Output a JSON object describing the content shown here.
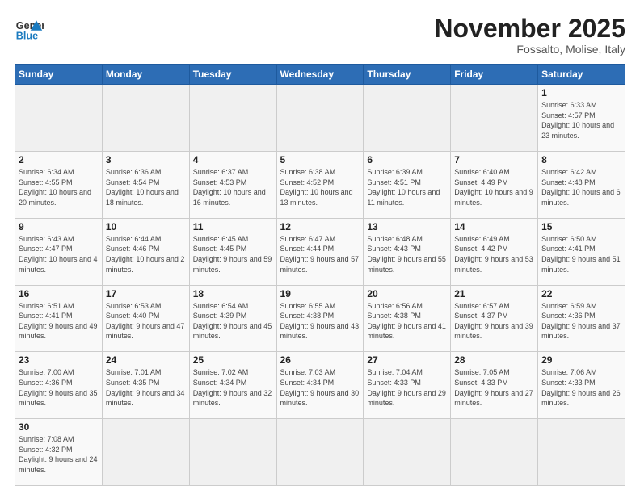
{
  "logo": {
    "text_general": "General",
    "text_blue": "Blue"
  },
  "header": {
    "month": "November 2025",
    "location": "Fossalto, Molise, Italy"
  },
  "weekdays": [
    "Sunday",
    "Monday",
    "Tuesday",
    "Wednesday",
    "Thursday",
    "Friday",
    "Saturday"
  ],
  "weeks": [
    [
      {
        "day": "",
        "info": ""
      },
      {
        "day": "",
        "info": ""
      },
      {
        "day": "",
        "info": ""
      },
      {
        "day": "",
        "info": ""
      },
      {
        "day": "",
        "info": ""
      },
      {
        "day": "",
        "info": ""
      },
      {
        "day": "1",
        "info": "Sunrise: 6:33 AM\nSunset: 4:57 PM\nDaylight: 10 hours and 23 minutes."
      }
    ],
    [
      {
        "day": "2",
        "info": "Sunrise: 6:34 AM\nSunset: 4:55 PM\nDaylight: 10 hours and 20 minutes."
      },
      {
        "day": "3",
        "info": "Sunrise: 6:36 AM\nSunset: 4:54 PM\nDaylight: 10 hours and 18 minutes."
      },
      {
        "day": "4",
        "info": "Sunrise: 6:37 AM\nSunset: 4:53 PM\nDaylight: 10 hours and 16 minutes."
      },
      {
        "day": "5",
        "info": "Sunrise: 6:38 AM\nSunset: 4:52 PM\nDaylight: 10 hours and 13 minutes."
      },
      {
        "day": "6",
        "info": "Sunrise: 6:39 AM\nSunset: 4:51 PM\nDaylight: 10 hours and 11 minutes."
      },
      {
        "day": "7",
        "info": "Sunrise: 6:40 AM\nSunset: 4:49 PM\nDaylight: 10 hours and 9 minutes."
      },
      {
        "day": "8",
        "info": "Sunrise: 6:42 AM\nSunset: 4:48 PM\nDaylight: 10 hours and 6 minutes."
      }
    ],
    [
      {
        "day": "9",
        "info": "Sunrise: 6:43 AM\nSunset: 4:47 PM\nDaylight: 10 hours and 4 minutes."
      },
      {
        "day": "10",
        "info": "Sunrise: 6:44 AM\nSunset: 4:46 PM\nDaylight: 10 hours and 2 minutes."
      },
      {
        "day": "11",
        "info": "Sunrise: 6:45 AM\nSunset: 4:45 PM\nDaylight: 9 hours and 59 minutes."
      },
      {
        "day": "12",
        "info": "Sunrise: 6:47 AM\nSunset: 4:44 PM\nDaylight: 9 hours and 57 minutes."
      },
      {
        "day": "13",
        "info": "Sunrise: 6:48 AM\nSunset: 4:43 PM\nDaylight: 9 hours and 55 minutes."
      },
      {
        "day": "14",
        "info": "Sunrise: 6:49 AM\nSunset: 4:42 PM\nDaylight: 9 hours and 53 minutes."
      },
      {
        "day": "15",
        "info": "Sunrise: 6:50 AM\nSunset: 4:41 PM\nDaylight: 9 hours and 51 minutes."
      }
    ],
    [
      {
        "day": "16",
        "info": "Sunrise: 6:51 AM\nSunset: 4:41 PM\nDaylight: 9 hours and 49 minutes."
      },
      {
        "day": "17",
        "info": "Sunrise: 6:53 AM\nSunset: 4:40 PM\nDaylight: 9 hours and 47 minutes."
      },
      {
        "day": "18",
        "info": "Sunrise: 6:54 AM\nSunset: 4:39 PM\nDaylight: 9 hours and 45 minutes."
      },
      {
        "day": "19",
        "info": "Sunrise: 6:55 AM\nSunset: 4:38 PM\nDaylight: 9 hours and 43 minutes."
      },
      {
        "day": "20",
        "info": "Sunrise: 6:56 AM\nSunset: 4:38 PM\nDaylight: 9 hours and 41 minutes."
      },
      {
        "day": "21",
        "info": "Sunrise: 6:57 AM\nSunset: 4:37 PM\nDaylight: 9 hours and 39 minutes."
      },
      {
        "day": "22",
        "info": "Sunrise: 6:59 AM\nSunset: 4:36 PM\nDaylight: 9 hours and 37 minutes."
      }
    ],
    [
      {
        "day": "23",
        "info": "Sunrise: 7:00 AM\nSunset: 4:36 PM\nDaylight: 9 hours and 35 minutes."
      },
      {
        "day": "24",
        "info": "Sunrise: 7:01 AM\nSunset: 4:35 PM\nDaylight: 9 hours and 34 minutes."
      },
      {
        "day": "25",
        "info": "Sunrise: 7:02 AM\nSunset: 4:34 PM\nDaylight: 9 hours and 32 minutes."
      },
      {
        "day": "26",
        "info": "Sunrise: 7:03 AM\nSunset: 4:34 PM\nDaylight: 9 hours and 30 minutes."
      },
      {
        "day": "27",
        "info": "Sunrise: 7:04 AM\nSunset: 4:33 PM\nDaylight: 9 hours and 29 minutes."
      },
      {
        "day": "28",
        "info": "Sunrise: 7:05 AM\nSunset: 4:33 PM\nDaylight: 9 hours and 27 minutes."
      },
      {
        "day": "29",
        "info": "Sunrise: 7:06 AM\nSunset: 4:33 PM\nDaylight: 9 hours and 26 minutes."
      }
    ],
    [
      {
        "day": "30",
        "info": "Sunrise: 7:08 AM\nSunset: 4:32 PM\nDaylight: 9 hours and 24 minutes."
      },
      {
        "day": "",
        "info": ""
      },
      {
        "day": "",
        "info": ""
      },
      {
        "day": "",
        "info": ""
      },
      {
        "day": "",
        "info": ""
      },
      {
        "day": "",
        "info": ""
      },
      {
        "day": "",
        "info": ""
      }
    ]
  ]
}
